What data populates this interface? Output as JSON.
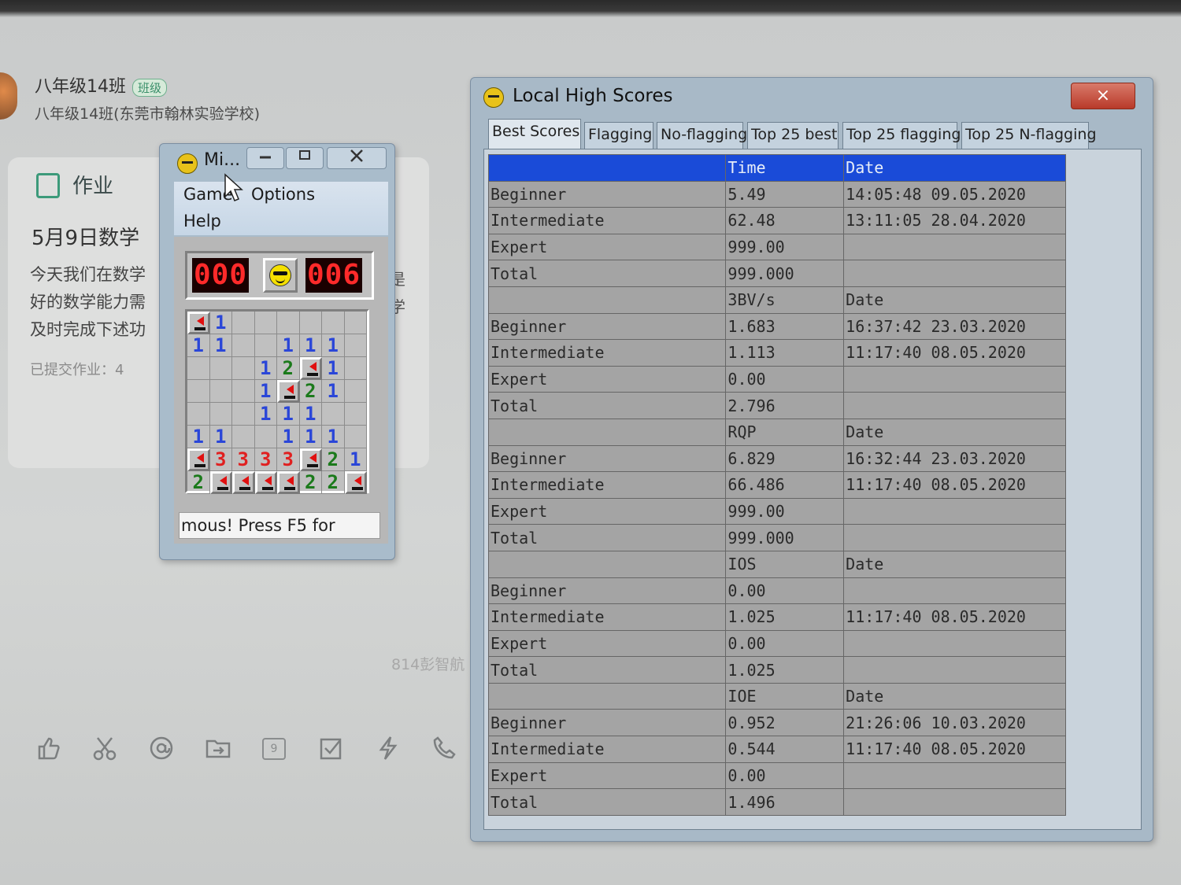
{
  "chat": {
    "title": "八年级14班",
    "badge": "班级",
    "subtitle": "八年级14班(东莞市翰林实验学校)"
  },
  "homework": {
    "label": "作业",
    "date_title": "5月9日数学",
    "body_lines": [
      "今天我们在数学",
      "好的数学能力需",
      "及时完成下述功"
    ],
    "submitted": "已提交作业：4",
    "right_fragments": [
      "是",
      "学"
    ]
  },
  "watermark": "814彭智航",
  "toolbar_icons": [
    "thumbs-up-icon",
    "scissors-icon",
    "at-icon",
    "folder-icon",
    "calendar-icon",
    "checkbox-icon",
    "lightning-icon",
    "phone-icon"
  ],
  "calendar_day": "9",
  "minesweeper": {
    "title": "Mi...",
    "menu": {
      "game": "Game",
      "options": "Options",
      "help": "Help"
    },
    "mines_left": "000",
    "timer": "006",
    "status": "mous! Press F5 for",
    "grid": [
      [
        "F",
        "1",
        "",
        "",
        "",
        "",
        "",
        ""
      ],
      [
        "1",
        "1",
        "",
        "",
        "1",
        "1",
        "1",
        ""
      ],
      [
        "",
        "",
        "",
        "1",
        "2",
        "F",
        "1",
        ""
      ],
      [
        "",
        "",
        "",
        "1",
        "F",
        "2",
        "1",
        ""
      ],
      [
        "",
        "",
        "",
        "1",
        "1",
        "1",
        "",
        ""
      ],
      [
        "1",
        "1",
        "",
        "",
        "1",
        "1",
        "1",
        ""
      ],
      [
        "F",
        "3",
        "3",
        "3",
        "3",
        "F",
        "2",
        "1"
      ],
      [
        "2",
        "F",
        "F",
        "F",
        "F",
        "2",
        "2",
        "F"
      ]
    ]
  },
  "high_scores": {
    "title": "Local High Scores",
    "close": "×",
    "tabs": [
      "Best Scores",
      "Flagging",
      "No-flagging",
      "Top 25 best",
      "Top 25 flagging",
      "Top 25 N-flagging"
    ],
    "active_tab": "Best Scores",
    "sections": [
      {
        "metric": "Time",
        "date_header": "Date",
        "rows": [
          {
            "level": "Beginner",
            "value": "5.49",
            "date": "14:05:48 09.05.2020"
          },
          {
            "level": "Intermediate",
            "value": "62.48",
            "date": "13:11:05 28.04.2020"
          },
          {
            "level": "Expert",
            "value": "999.00",
            "date": ""
          },
          {
            "level": "Total",
            "value": "999.000",
            "date": ""
          }
        ]
      },
      {
        "metric": "3BV/s",
        "date_header": "Date",
        "rows": [
          {
            "level": "Beginner",
            "value": "1.683",
            "date": "16:37:42 23.03.2020"
          },
          {
            "level": "Intermediate",
            "value": "1.113",
            "date": "11:17:40 08.05.2020"
          },
          {
            "level": "Expert",
            "value": "0.00",
            "date": ""
          },
          {
            "level": "Total",
            "value": "2.796",
            "date": ""
          }
        ]
      },
      {
        "metric": "RQP",
        "date_header": "Date",
        "rows": [
          {
            "level": "Beginner",
            "value": "6.829",
            "date": "16:32:44 23.03.2020"
          },
          {
            "level": "Intermediate",
            "value": "66.486",
            "date": "11:17:40 08.05.2020"
          },
          {
            "level": "Expert",
            "value": "999.00",
            "date": ""
          },
          {
            "level": "Total",
            "value": "999.000",
            "date": ""
          }
        ]
      },
      {
        "metric": "IOS",
        "date_header": "Date",
        "rows": [
          {
            "level": "Beginner",
            "value": "0.00",
            "date": ""
          },
          {
            "level": "Intermediate",
            "value": "1.025",
            "date": "11:17:40 08.05.2020"
          },
          {
            "level": "Expert",
            "value": "0.00",
            "date": ""
          },
          {
            "level": "Total",
            "value": "1.025",
            "date": ""
          }
        ]
      },
      {
        "metric": "IOE",
        "date_header": "Date",
        "rows": [
          {
            "level": "Beginner",
            "value": "0.952",
            "date": "21:26:06 10.03.2020"
          },
          {
            "level": "Intermediate",
            "value": "0.544",
            "date": "11:17:40 08.05.2020"
          },
          {
            "level": "Expert",
            "value": "0.00",
            "date": ""
          },
          {
            "level": "Total",
            "value": "1.496",
            "date": ""
          }
        ]
      }
    ]
  },
  "colors": {
    "header_blue": "#1a4bd8",
    "led_red": "#ff2a2a",
    "number_one": "#2a46d8",
    "number_two": "#1b7a1b",
    "number_three": "#e02020"
  }
}
